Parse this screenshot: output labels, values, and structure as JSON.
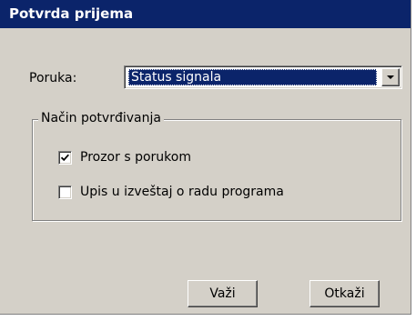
{
  "window": {
    "title": "Potvrda prijema"
  },
  "message": {
    "label": "Poruka:",
    "selected_value": "Status signala",
    "dropdown_icon": "chevron-down-icon"
  },
  "confirmation_mode": {
    "legend": "Način potvrđivanja",
    "options": [
      {
        "label": "Prozor s porukom",
        "checked": true
      },
      {
        "label": "Upis u izveštaj o radu programa",
        "checked": false
      }
    ]
  },
  "buttons": {
    "ok_label": "Važi",
    "cancel_label": "Otkaži"
  },
  "colors": {
    "title_bar": "#0b246a",
    "dialog_background": "#d4d0c8",
    "selection": "#0b246a"
  }
}
